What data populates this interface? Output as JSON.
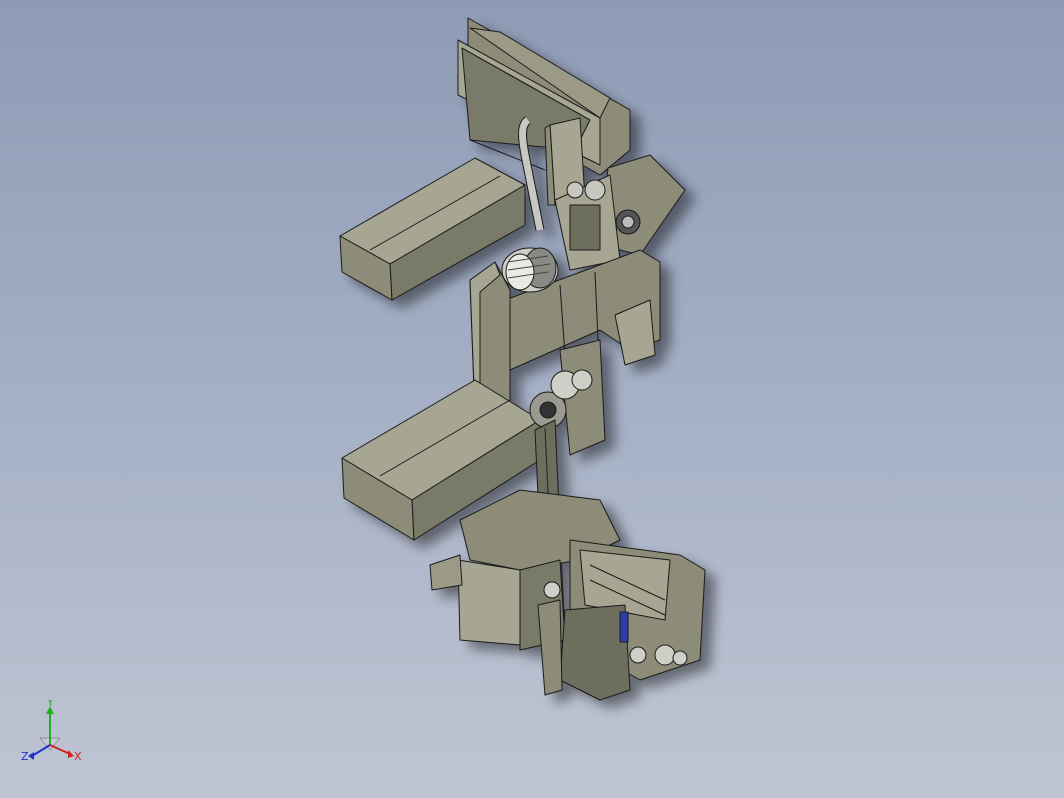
{
  "viewport": {
    "background_top": "#8e9bb5",
    "background_bottom": "#bfc5d3"
  },
  "model": {
    "body_color": "#8c8c78",
    "body_dark": "#6e6e5e",
    "body_light": "#a6a692",
    "edge_color": "#1a1a1a",
    "accent_blue": "#2a3fa8"
  },
  "triad": {
    "x_label": "X",
    "y_label": "Y",
    "z_label": "Z",
    "x_color": "#d42020",
    "y_color": "#20b020",
    "z_color": "#2030d0"
  }
}
